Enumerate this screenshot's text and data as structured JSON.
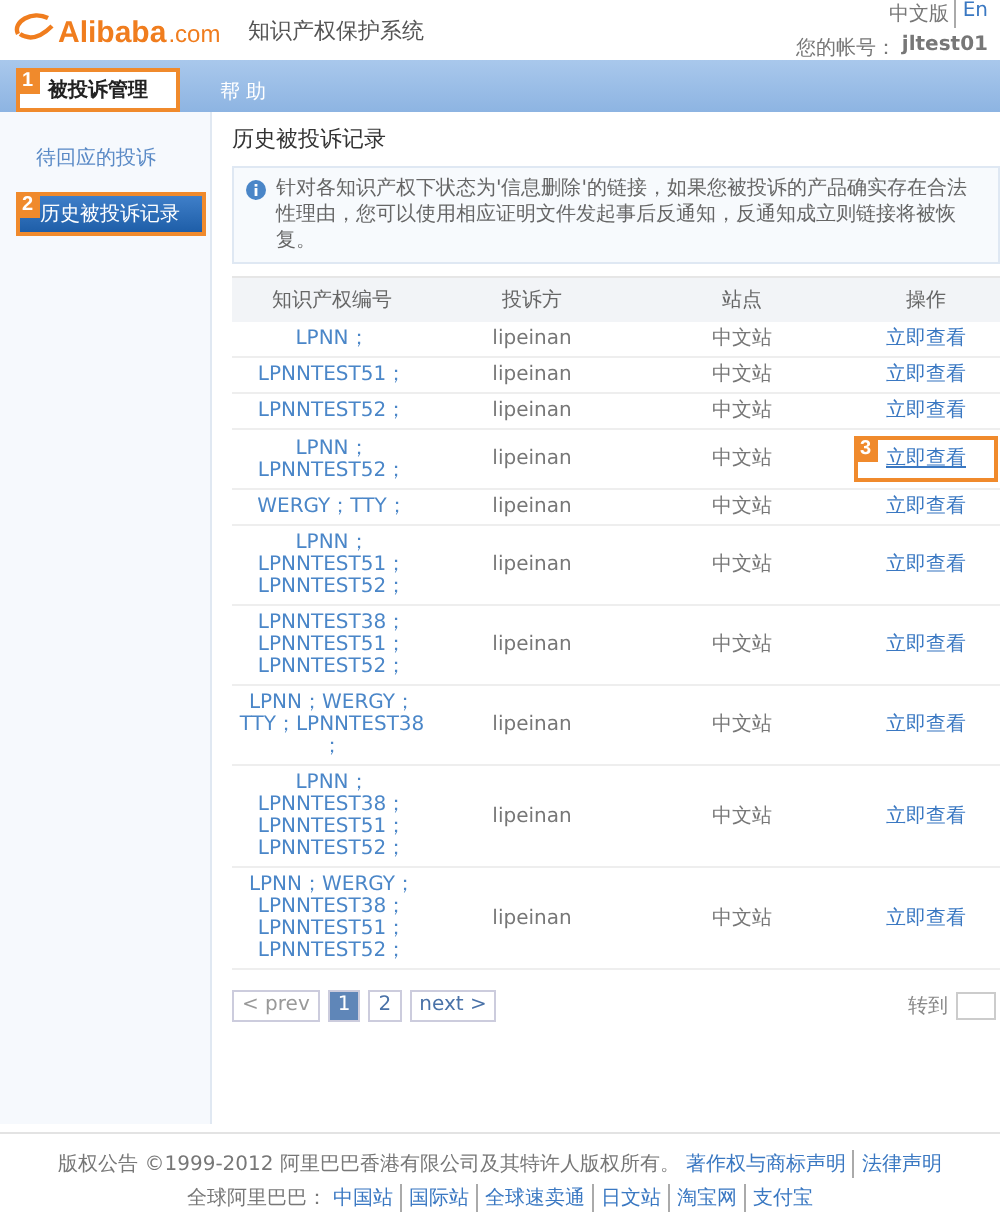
{
  "header": {
    "logo": "Alibaba",
    "logo_suffix": ".com",
    "system_title": "知识产权保护系统",
    "languages": [
      {
        "label": "中文版",
        "selected": true
      },
      {
        "label": "En",
        "selected": false
      }
    ],
    "account_label": "您的帐号：",
    "account": "jltest01"
  },
  "nav_tabs": [
    {
      "label": "被投诉管理",
      "selected": true,
      "callout": "1"
    },
    {
      "label": "帮 助",
      "selected": false
    }
  ],
  "sidebar": {
    "items": [
      {
        "label": "待回应的投诉",
        "selected": false
      },
      {
        "label": "历史被投诉记录",
        "selected": true,
        "callout": "2"
      }
    ]
  },
  "page_title": "历史被投诉记录",
  "notice": "针对各知识产权下状态为'信息删除'的链接，如果您被投诉的产品确实存在合法性理由，您可以使用相应证明文件发起事后反通知，反通知成立则链接将被恢复。",
  "table": {
    "columns": [
      "知识产权编号",
      "投诉方",
      "站点",
      "操作"
    ],
    "rows": [
      {
        "ip_numbers": [
          "LPNN；"
        ],
        "complainant": "lipeinan",
        "site": "中文站",
        "action": "立即查看"
      },
      {
        "ip_numbers": [
          "LPNNTEST51；"
        ],
        "complainant": "lipeinan",
        "site": "中文站",
        "action": "立即查看"
      },
      {
        "ip_numbers": [
          "LPNNTEST52；"
        ],
        "complainant": "lipeinan",
        "site": "中文站",
        "action": "立即查看"
      },
      {
        "ip_numbers": [
          "LPNN；",
          "LPNNTEST52；"
        ],
        "complainant": "lipeinan",
        "site": "中文站",
        "action": "立即查看",
        "callout": "3"
      },
      {
        "ip_numbers": [
          "WERGY；TTY；"
        ],
        "complainant": "lipeinan",
        "site": "中文站",
        "action": "立即查看"
      },
      {
        "ip_numbers": [
          "LPNN；",
          "LPNNTEST51；",
          "LPNNTEST52；"
        ],
        "complainant": "lipeinan",
        "site": "中文站",
        "action": "立即查看"
      },
      {
        "ip_numbers": [
          "LPNNTEST38；",
          "LPNNTEST51；",
          "LPNNTEST52；"
        ],
        "complainant": "lipeinan",
        "site": "中文站",
        "action": "立即查看"
      },
      {
        "ip_numbers": [
          "LPNN；WERGY；",
          "TTY；LPNNTEST38",
          "；"
        ],
        "complainant": "lipeinan",
        "site": "中文站",
        "action": "立即查看"
      },
      {
        "ip_numbers": [
          "LPNN；",
          "LPNNTEST38；",
          "LPNNTEST51；",
          "LPNNTEST52；"
        ],
        "complainant": "lipeinan",
        "site": "中文站",
        "action": "立即查看"
      },
      {
        "ip_numbers": [
          "LPNN；WERGY；",
          "LPNNTEST38；",
          "LPNNTEST51；",
          "LPNNTEST52；"
        ],
        "complainant": "lipeinan",
        "site": "中文站",
        "action": "立即查看"
      }
    ]
  },
  "pagination": {
    "prev": {
      "label": "< prev",
      "disabled": true
    },
    "pages": [
      {
        "label": "1",
        "selected": true
      },
      {
        "label": "2",
        "selected": false
      }
    ],
    "next": {
      "label": "next >",
      "disabled": false
    },
    "goto_label": "转到"
  },
  "footer": {
    "copyright": "版权公告 ©1999-2012 阿里巴巴香港有限公司及其特许人版权所有。",
    "legal_links": [
      "著作权与商标声明",
      "法律声明"
    ],
    "global_label": "全球阿里巴巴：",
    "global_links": [
      "中国站",
      "国际站",
      "全球速卖通",
      "日文站",
      "淘宝网",
      "支付宝"
    ]
  }
}
